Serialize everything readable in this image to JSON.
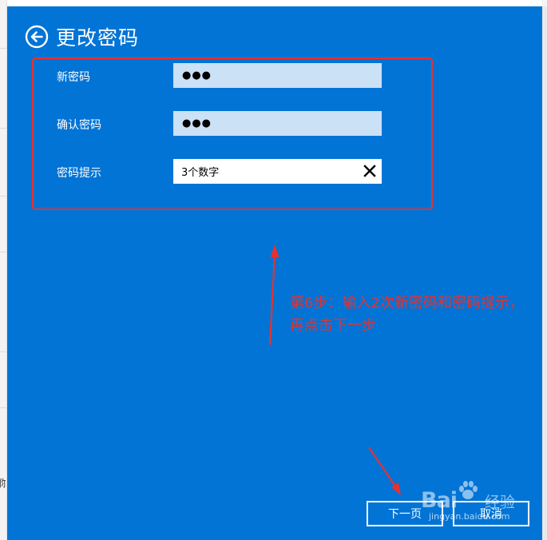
{
  "header": {
    "title": "更改密码"
  },
  "form": {
    "new_password": {
      "label": "新密码",
      "value": "●●●"
    },
    "confirm_password": {
      "label": "确认密码",
      "value": "●●●"
    },
    "password_hint": {
      "label": "密码提示",
      "value": "3个数字"
    }
  },
  "annotation": {
    "text": "第6步：输入2次新密码和密码提示，再点击下一步"
  },
  "buttons": {
    "next": "下一页",
    "cancel": "取消"
  },
  "watermark": {
    "brand": "Bai",
    "suffix": "经验",
    "domain": "jingyan.baidu.com"
  },
  "background_edge": {
    "cut_char": "你"
  },
  "colors": {
    "panel": "#0174d6",
    "input_bg": "#cbe1f6",
    "annotation": "#e8312f"
  },
  "icons": {
    "back": "back-arrow-circle-icon",
    "clear": "close-x-icon"
  }
}
